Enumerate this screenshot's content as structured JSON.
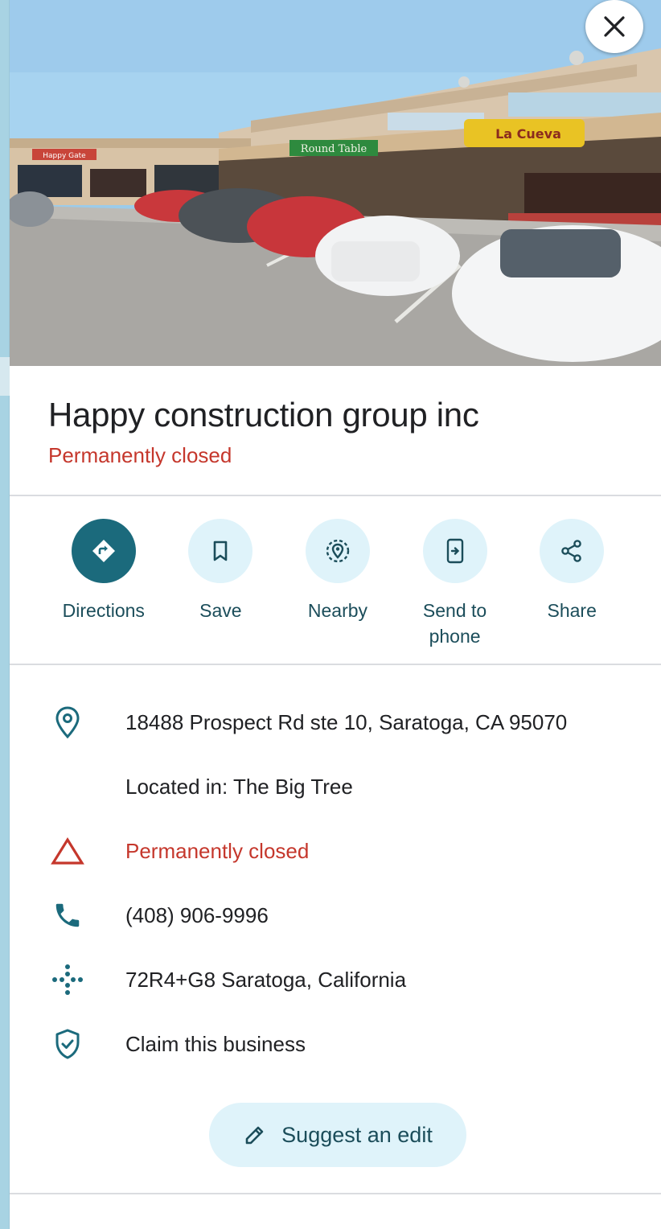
{
  "place": {
    "title": "Happy construction group inc",
    "status": "Permanently closed"
  },
  "actions": [
    {
      "label": "Directions",
      "icon": "directions-icon"
    },
    {
      "label": "Save",
      "icon": "bookmark-icon"
    },
    {
      "label": "Nearby",
      "icon": "nearby-icon"
    },
    {
      "label": "Send to phone",
      "icon": "send-to-phone-icon"
    },
    {
      "label": "Share",
      "icon": "share-icon"
    }
  ],
  "info": {
    "address": "18488 Prospect Rd ste 10, Saratoga, CA 95070",
    "located_in": "Located in: The Big Tree",
    "status": "Permanently closed",
    "phone": "(408) 906-9996",
    "plus_code": "72R4+G8 Saratoga, California",
    "claim": "Claim this business"
  },
  "suggest_edit": "Suggest an edit",
  "photo_signs": {
    "sign1": "La Cueva",
    "sign2": "Round Table",
    "sign3": "Happy Gate"
  },
  "colors": {
    "accent": "#1b6a7c",
    "action_bg": "#dff3fa",
    "closed_red": "#c5372c"
  }
}
